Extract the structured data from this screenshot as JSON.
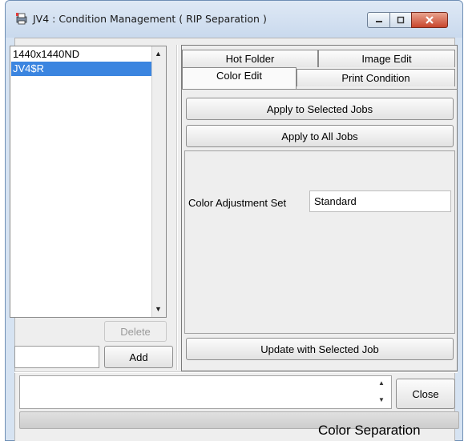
{
  "window": {
    "title": "JV4 : Condition Management ( RIP Separation )"
  },
  "icons": {
    "app": "printer-app-icon",
    "minimize": "minimize-icon",
    "maximize": "maximize-icon",
    "close": "close-icon"
  },
  "conditions": {
    "items": [
      {
        "label": "1440x1440ND",
        "selected": false
      },
      {
        "label": "JV4$R",
        "selected": true
      }
    ],
    "delete_label": "Delete",
    "add_label": "Add",
    "name_value": ""
  },
  "tabs": {
    "row_back": [
      "Hot Folder",
      "Image Edit"
    ],
    "row_front": [
      "Color Edit",
      "Print Condition"
    ],
    "active": "Color Edit"
  },
  "color_edit": {
    "apply_selected_label": "Apply to Selected Jobs",
    "apply_all_label": "Apply to All Jobs",
    "adjustment_label": "Color Adjustment Set",
    "adjustment_value": "Standard",
    "update_label": "Update with Selected Job"
  },
  "footer": {
    "message": "",
    "close_label": "Close",
    "status": "Color Separation"
  },
  "colors": {
    "selection": "#3b85e0",
    "close_button": "#c8452d"
  }
}
